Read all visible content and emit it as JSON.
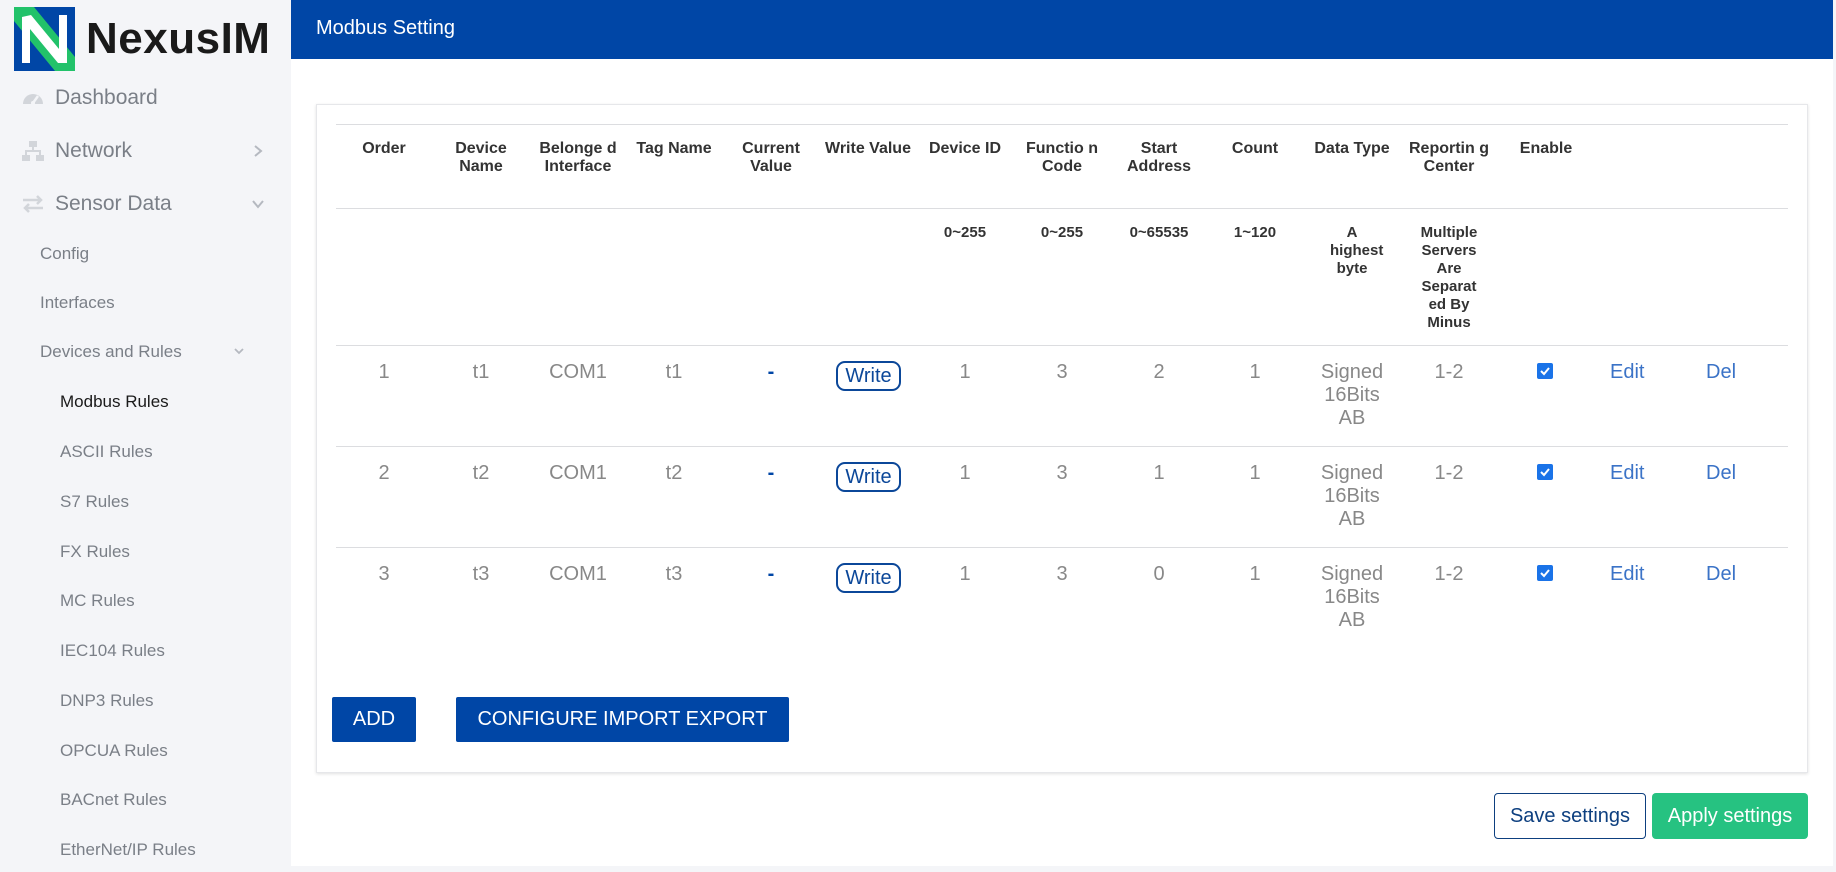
{
  "brand": {
    "name": "NexusIM"
  },
  "sidebar": {
    "top_items": [
      {
        "label": "Dashboard",
        "icon": "dashboard-icon"
      },
      {
        "label": "Network",
        "icon": "network-icon"
      },
      {
        "label": "Sensor Data",
        "icon": "sensor-data-icon"
      }
    ],
    "sub_items": [
      {
        "label": "Config"
      },
      {
        "label": "Interfaces"
      },
      {
        "label": "Devices and Rules"
      }
    ],
    "leaf_items": [
      {
        "label": "Modbus Rules",
        "active": true
      },
      {
        "label": "ASCII Rules"
      },
      {
        "label": "S7 Rules"
      },
      {
        "label": "FX Rules"
      },
      {
        "label": "MC Rules"
      },
      {
        "label": "IEC104 Rules"
      },
      {
        "label": "DNP3 Rules"
      },
      {
        "label": "OPCUA Rules"
      },
      {
        "label": "BACnet Rules"
      },
      {
        "label": "EtherNet/IP Rules"
      }
    ]
  },
  "header": {
    "title": "Modbus Setting"
  },
  "table": {
    "headers": [
      "Order",
      "Device Name",
      "Belonge d Interface",
      "Tag Name",
      "Current Value",
      "Write Value",
      "Device ID",
      "Functio n Code",
      "Start Address",
      "Count",
      "Data Type",
      "Reportin g Center",
      "Enable"
    ],
    "ranges": {
      "device_id": "0~255",
      "function_code": "0~255",
      "start_address": "0~65535",
      "count": "1~120",
      "data_type": "A highest byte",
      "reporting_center": "Multiple Servers Are Separat ed By Minus"
    },
    "rows": [
      {
        "order": "1",
        "device_name": "t1",
        "interface": "COM1",
        "tag_name": "t1",
        "current_value": "-",
        "write_label": "Write",
        "device_id": "1",
        "function_code": "3",
        "start_address": "2",
        "count": "1",
        "data_type": "Signed 16Bits AB",
        "reporting_center": "1-2",
        "enabled": true,
        "edit_label": "Edit",
        "del_label": "Del"
      },
      {
        "order": "2",
        "device_name": "t2",
        "interface": "COM1",
        "tag_name": "t2",
        "current_value": "-",
        "write_label": "Write",
        "device_id": "1",
        "function_code": "3",
        "start_address": "1",
        "count": "1",
        "data_type": "Signed 16Bits AB",
        "reporting_center": "1-2",
        "enabled": true,
        "edit_label": "Edit",
        "del_label": "Del"
      },
      {
        "order": "3",
        "device_name": "t3",
        "interface": "COM1",
        "tag_name": "t3",
        "current_value": "-",
        "write_label": "Write",
        "device_id": "1",
        "function_code": "3",
        "start_address": "0",
        "count": "1",
        "data_type": "Signed 16Bits AB",
        "reporting_center": "1-2",
        "enabled": true,
        "edit_label": "Edit",
        "del_label": "Del"
      }
    ]
  },
  "actions": {
    "add_label": "ADD",
    "import_export_label": "CONFIGURE IMPORT EXPORT",
    "save_label": "Save settings",
    "apply_label": "Apply settings"
  },
  "colors": {
    "primary": "#0046a6",
    "apply": "#26c281",
    "link": "#3b73c7",
    "sidebar_bg": "#f4f5f8"
  }
}
